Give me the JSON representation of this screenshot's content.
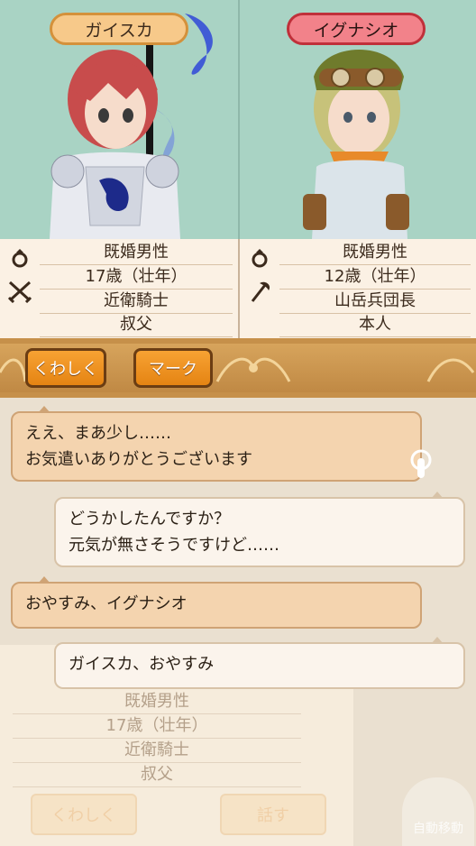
{
  "characters": {
    "left": {
      "name": "ガイスカ",
      "rows": [
        "既婚男性",
        "17歳（壮年）",
        "近衛騎士",
        "叔父"
      ],
      "icons": [
        "ring-icon",
        "crossed-swords-icon"
      ]
    },
    "right": {
      "name": "イグナシオ",
      "rows": [
        "既婚男性",
        "12歳（壮年）",
        "山岳兵団長",
        "本人"
      ],
      "icons": [
        "ring-icon",
        "axe-icon"
      ]
    }
  },
  "toolbar": {
    "detail_label": "くわしく",
    "mark_label": "マーク"
  },
  "dialogue": [
    {
      "speaker": "left",
      "lines": [
        "ええ、まあ少し……",
        "お気遣いありがとうございます"
      ]
    },
    {
      "speaker": "right",
      "lines": [
        "どうかしたんですか？",
        "元気が無さそうですけど……"
      ]
    },
    {
      "speaker": "left",
      "lines": [
        "おやすみ、イグナシオ"
      ]
    },
    {
      "speaker": "right",
      "lines": [
        "ガイスカ、おやすみ"
      ]
    }
  ],
  "background_panel": {
    "rows": [
      "既婚男性",
      "17歳（壮年）",
      "近衛騎士",
      "叔父"
    ],
    "detail_label": "くわしく",
    "talk_label": "話す"
  },
  "auto_move_label": "自動移動",
  "colors": {
    "pill_left": "#f7c98a",
    "pill_right": "#f2828a",
    "button_orange": "#f29a2a",
    "bubble_orange": "#f4d4af",
    "bubble_white": "#fbf4ec"
  }
}
